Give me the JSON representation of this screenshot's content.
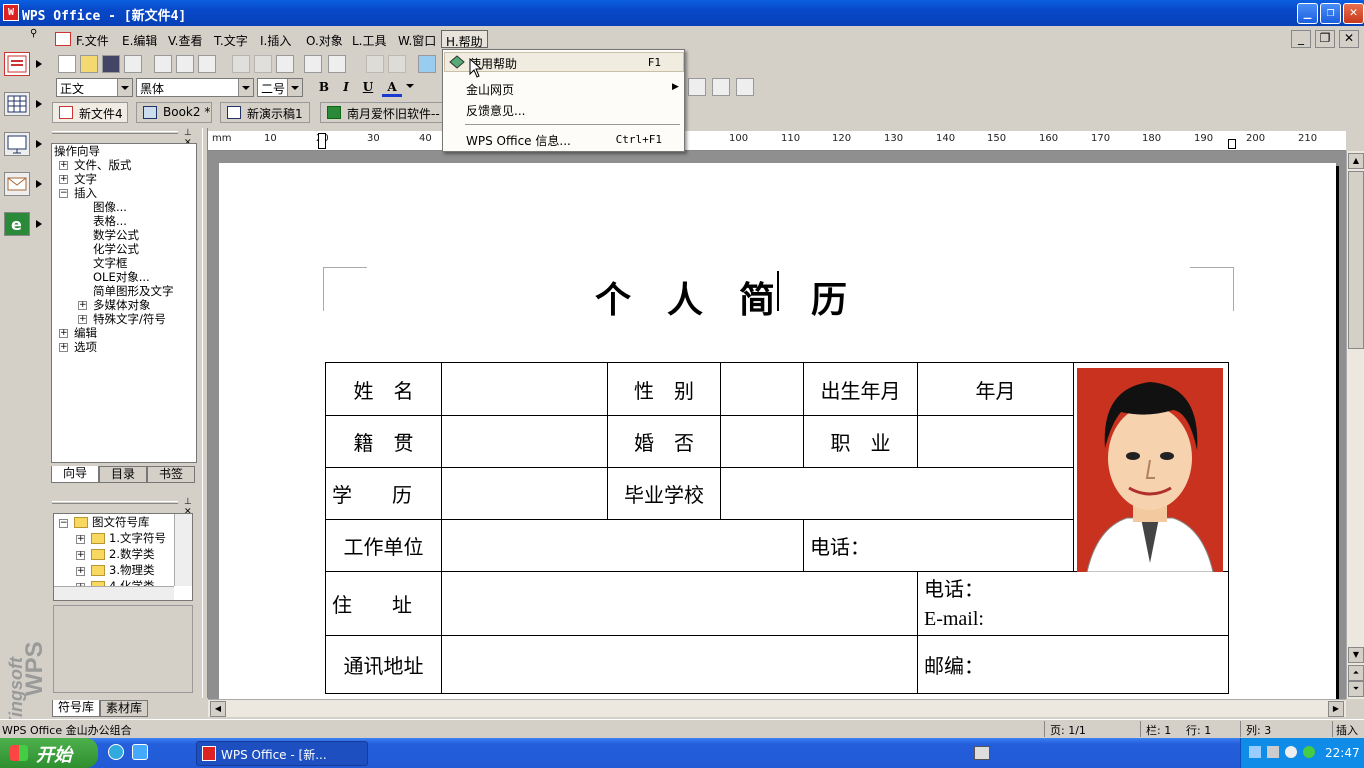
{
  "window": {
    "title": "WPS Office - [新文件4]"
  },
  "menu": {
    "items": [
      "F.文件",
      "E.编辑",
      "V.查看",
      "T.文字",
      "I.插入",
      "O.对象",
      "L.工具",
      "W.窗口",
      "H.帮助"
    ],
    "active_index": 8
  },
  "toolbar": {
    "style_value": "正文",
    "font_value": "黑体",
    "size_value": "二号",
    "bold": "B",
    "italic": "I",
    "underline": "U",
    "fontcolor": "A"
  },
  "doc_tabs": [
    "新文件4",
    "Book2 *",
    "新演示稿1",
    "南月爱怀旧软件--"
  ],
  "help_menu": {
    "items": [
      {
        "label": "使用帮助",
        "shortcut": "F1",
        "prefix": "I"
      },
      {
        "label": "金山网页",
        "shortcut": "",
        "prefix": "W.",
        "submenu": true
      },
      {
        "label": "反馈意见...",
        "shortcut": "",
        "prefix": "F."
      },
      {
        "label": "WPS Office 信息...",
        "shortcut": "Ctrl+F1",
        "prefix": "A."
      }
    ]
  },
  "nav": {
    "root": "操作向导",
    "items": [
      "文件、版式",
      "文字",
      "插入",
      "图像...",
      "表格...",
      "数学公式",
      "化学公式",
      "文字框",
      "OLE对象...",
      "简单图形及文字",
      "多媒体对象",
      "特殊文字/符号",
      "编辑",
      "选项"
    ],
    "tabs": [
      "向导",
      "目录",
      "书签"
    ]
  },
  "symbols": {
    "root": "图文符号库",
    "items": [
      "1.文字符号",
      "2.数学类",
      "3.物理类",
      "4.化学类"
    ],
    "tabs": [
      "符号库",
      "素材库"
    ]
  },
  "ruler": {
    "unit": "mm",
    "labels": [
      "10",
      "20",
      "30",
      "40",
      "100",
      "110",
      "120",
      "130",
      "140",
      "150",
      "160",
      "170",
      "180",
      "190",
      "200",
      "210"
    ]
  },
  "document": {
    "title": "个　人　简　历",
    "rows": [
      [
        "姓　名",
        "",
        "性　别",
        "",
        "出生年月",
        "年月"
      ],
      [
        "籍　贯",
        "",
        "婚　否",
        "",
        "职　业",
        ""
      ],
      [
        "学　　历",
        "",
        "毕业学校",
        ""
      ],
      [
        "工作单位",
        "",
        "电话："
      ],
      [
        "住　　址",
        "",
        "电话：",
        "E-mail:"
      ],
      [
        "通讯地址",
        "",
        "邮编："
      ]
    ]
  },
  "status": {
    "left": "WPS Office 金山办公组合",
    "page": "页: 1/1",
    "col": "栏: 1",
    "line": "行: 1",
    "column": "列: 3",
    "mode": "插入"
  },
  "taskbar": {
    "start": "开始",
    "item": "WPS Office - [新...",
    "clock": "22:47"
  },
  "branding": {
    "vertical": "Kingsoft WPS"
  }
}
